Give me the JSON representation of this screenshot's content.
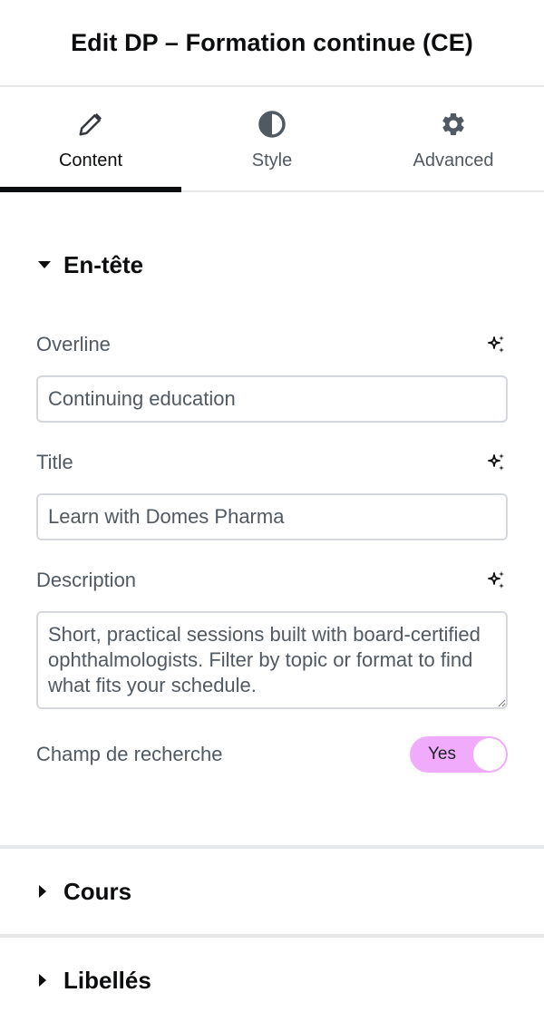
{
  "header": {
    "title": "Edit DP – Formation continue (CE)"
  },
  "tabs": [
    {
      "label": "Content",
      "icon": "pencil-icon",
      "active": true
    },
    {
      "label": "Style",
      "icon": "contrast-icon",
      "active": false
    },
    {
      "label": "Advanced",
      "icon": "gear-icon",
      "active": false
    }
  ],
  "section_header": {
    "title": "En-tête",
    "fields": {
      "overline": {
        "label": "Overline",
        "value": "Continuing education"
      },
      "title": {
        "label": "Title",
        "value": "Learn with Domes Pharma"
      },
      "description": {
        "label": "Description",
        "value": "Short, practical sessions built with board-certified ophthalmologists. Filter by topic or format to find what fits your schedule."
      },
      "search_toggle": {
        "label": "Champ de recherche",
        "state_label": "Yes",
        "on": true
      }
    }
  },
  "collapsed_sections": [
    {
      "title": "Cours"
    },
    {
      "title": "Libellés"
    }
  ],
  "colors": {
    "toggle_on": "#f0abfc",
    "active_tab": "#0c0d0e",
    "label": "#515962"
  }
}
